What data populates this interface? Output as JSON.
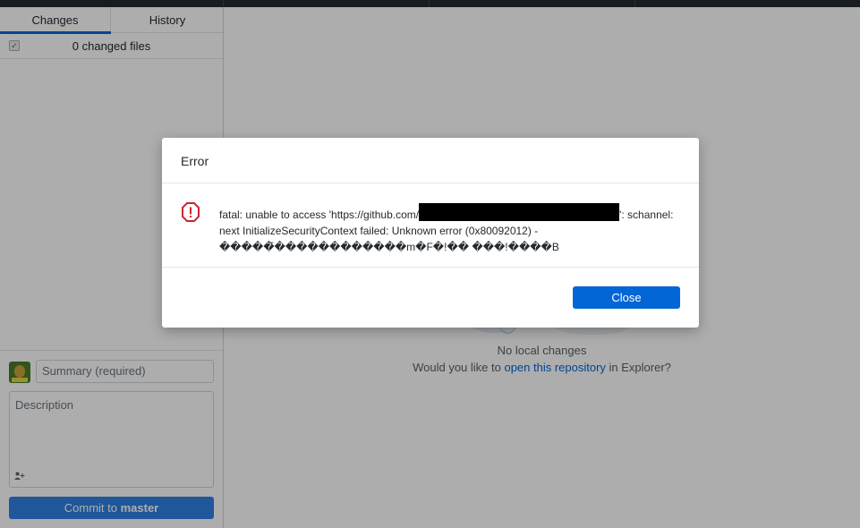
{
  "tabs": [
    {
      "label": "Changes",
      "selected": true
    },
    {
      "label": "History",
      "selected": false
    }
  ],
  "changes": {
    "select_all_checked": true,
    "select_all_icon": "checkmark-icon",
    "count_label": "0 changed files"
  },
  "commit": {
    "avatar_icon": "avocado-avatar",
    "summary_placeholder": "Summary (required)",
    "description_placeholder": "Description",
    "coauthor_icon": "add-coauthor-icon",
    "button_prefix": "Commit to ",
    "button_branch": "master"
  },
  "main": {
    "no_changes": "No local changes",
    "prompt_before": "Would you like to ",
    "prompt_link": "open this repository",
    "prompt_after": " in Explorer?"
  },
  "dialog": {
    "title": "Error",
    "icon": "alert-octagon-icon",
    "message_part1": "fatal: unable to access 'https://github.com/",
    "message_part2": "': schannel: next InitializeSecurityContext failed: Unknown error (0x80092012) - \u0000\u0000\u0000\u0000\u0000̃\u0000\u0000\u0000\u0000\u0000\u0000\u0000\u0000\u0000\u0000\u0000m\u0000F\u0000!\u0000\u0000 \u0000\u0000\u0000!\u0000\u0000\u0000\u0000B",
    "message_display_part2": "': schannel: next InitializeSecurityContext failed: Unknown error (0x80092012) - �����̃������������m�F�!�� ���!����B",
    "close_label": "Close"
  },
  "colors": {
    "accent": "#0366d6",
    "error_icon": "#cb2431",
    "commit_button": "#2f80e4",
    "redaction": "#000000"
  }
}
